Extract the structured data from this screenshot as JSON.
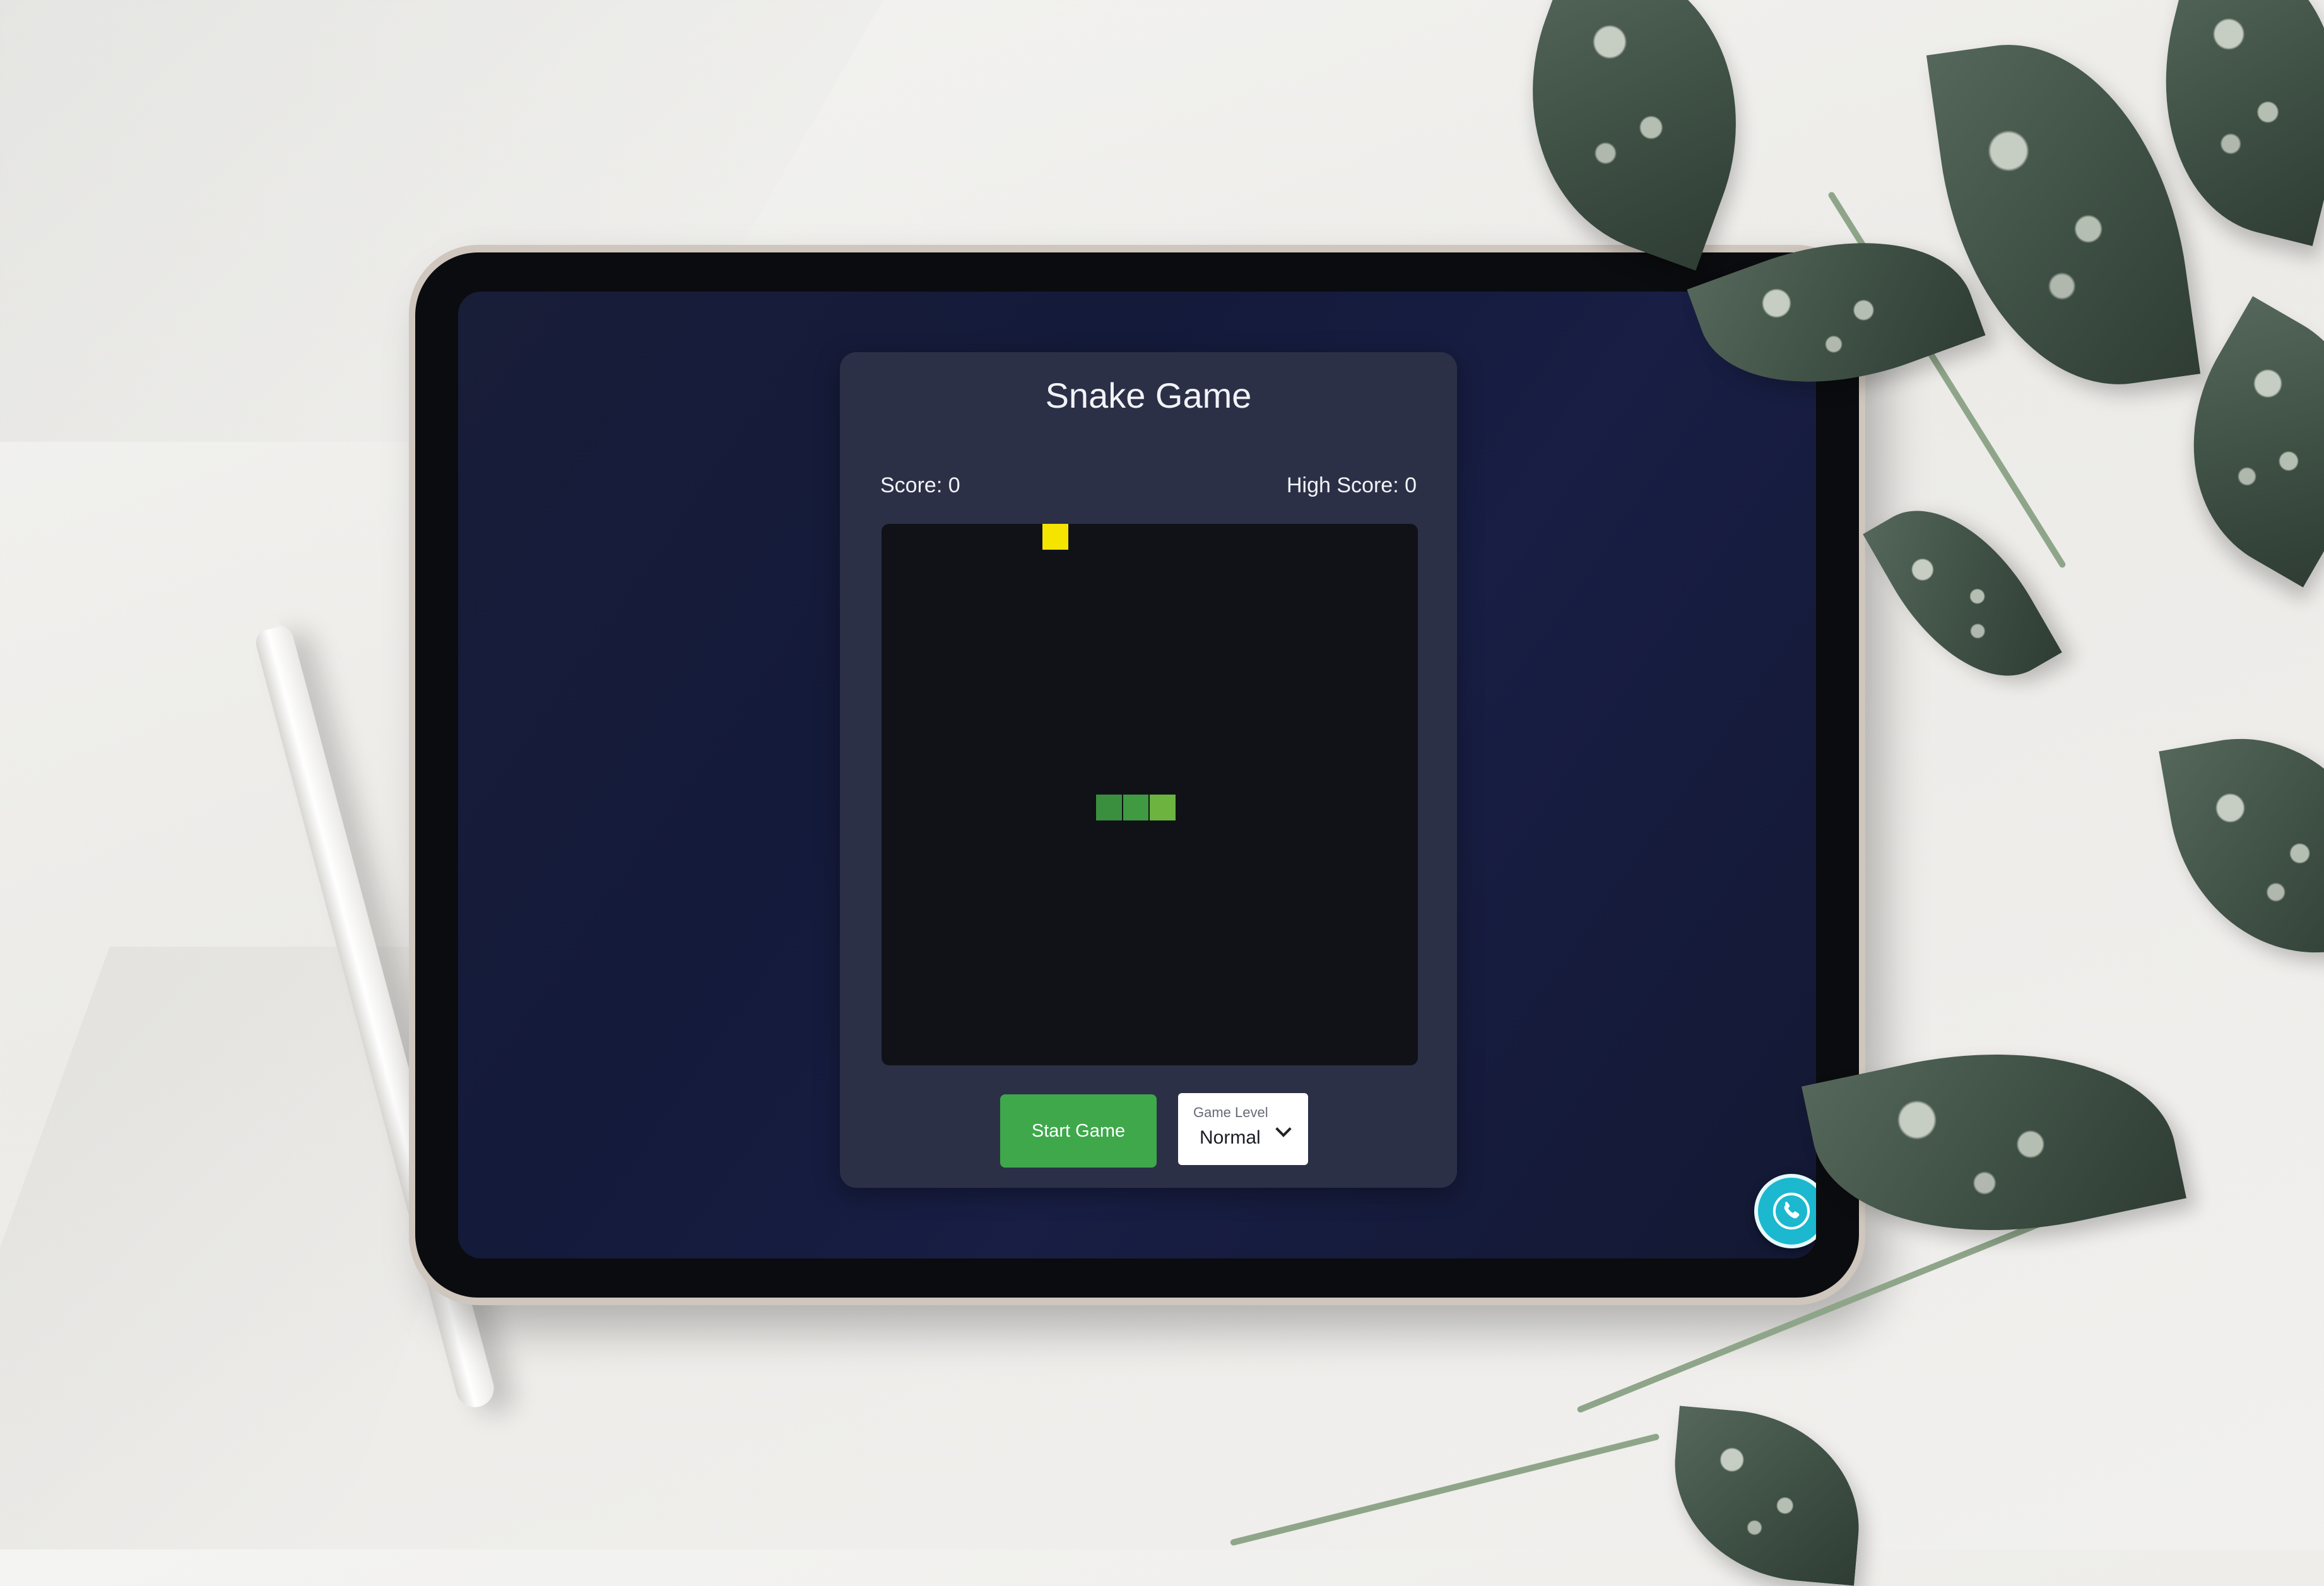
{
  "game": {
    "title": "Snake Game",
    "score_label": "Score: 0",
    "high_score_label": "High Score: 0",
    "score": 0,
    "high_score": 0,
    "grid": {
      "columns": 20,
      "rows": 20
    },
    "food": {
      "col": 6,
      "row": 0,
      "color": "#f4e400"
    },
    "snake": [
      {
        "col": 8,
        "row": 10,
        "color": "#3a8f3e"
      },
      {
        "col": 9,
        "row": 10,
        "color": "#3f9a42"
      },
      {
        "col": 10,
        "row": 10,
        "color": "#6db33f"
      }
    ]
  },
  "controls": {
    "start_label": "Start Game",
    "level_label": "Game Level",
    "level_value": "Normal"
  },
  "colors": {
    "accent_green": "#3ea84b",
    "call_button": "#1bb8cf",
    "board": "#101217",
    "card": "#2c3047"
  },
  "icons": {
    "call": "phone-icon",
    "dropdown": "chevron-down-icon"
  }
}
